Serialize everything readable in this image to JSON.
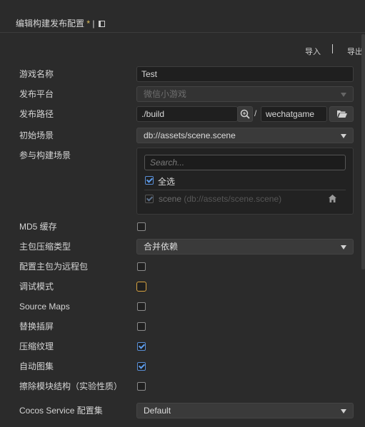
{
  "header": {
    "title": "编辑构建发布配置",
    "modified_mark": "*",
    "separator": "|",
    "import_label": "导入",
    "toolbar_separator": "|",
    "export_label": "导出"
  },
  "form": {
    "game_name": {
      "label": "游戏名称",
      "value": "Test"
    },
    "platform": {
      "label": "发布平台",
      "value": "微信小游戏"
    },
    "build_path": {
      "label": "发布路径",
      "path": "./build",
      "separator": "/",
      "folder": "wechatgame"
    },
    "start_scene": {
      "label": "初始场景",
      "value": "db://assets/scene.scene"
    },
    "included_scenes": {
      "label": "参与构建场景",
      "search_placeholder": "Search...",
      "select_all_label": "全选",
      "scene_name": "scene",
      "scene_path": "(db://assets/scene.scene)"
    },
    "md5_cache": {
      "label": "MD5 缓存",
      "checked": false
    },
    "main_bundle_compression": {
      "label": "主包压缩类型",
      "value": "合并依赖"
    },
    "main_bundle_remote": {
      "label": "配置主包为远程包",
      "checked": false
    },
    "debug_mode": {
      "label": "调试模式",
      "checked": false
    },
    "source_maps": {
      "label": "Source Maps",
      "checked": false
    },
    "replace_splash": {
      "label": "替换插屏",
      "checked": false
    },
    "compress_texture": {
      "label": "压缩纹理",
      "checked": true
    },
    "auto_atlas": {
      "label": "自动图集",
      "checked": true
    },
    "erase_module_structure": {
      "label": "擦除模块结构（实验性质）",
      "checked": false
    },
    "cocos_service": {
      "label": "Cocos Service 配置集",
      "value": "Default"
    }
  },
  "colors": {
    "accent": "#5d9cec",
    "focus": "#d9a441",
    "modified": "#e2c15a"
  }
}
